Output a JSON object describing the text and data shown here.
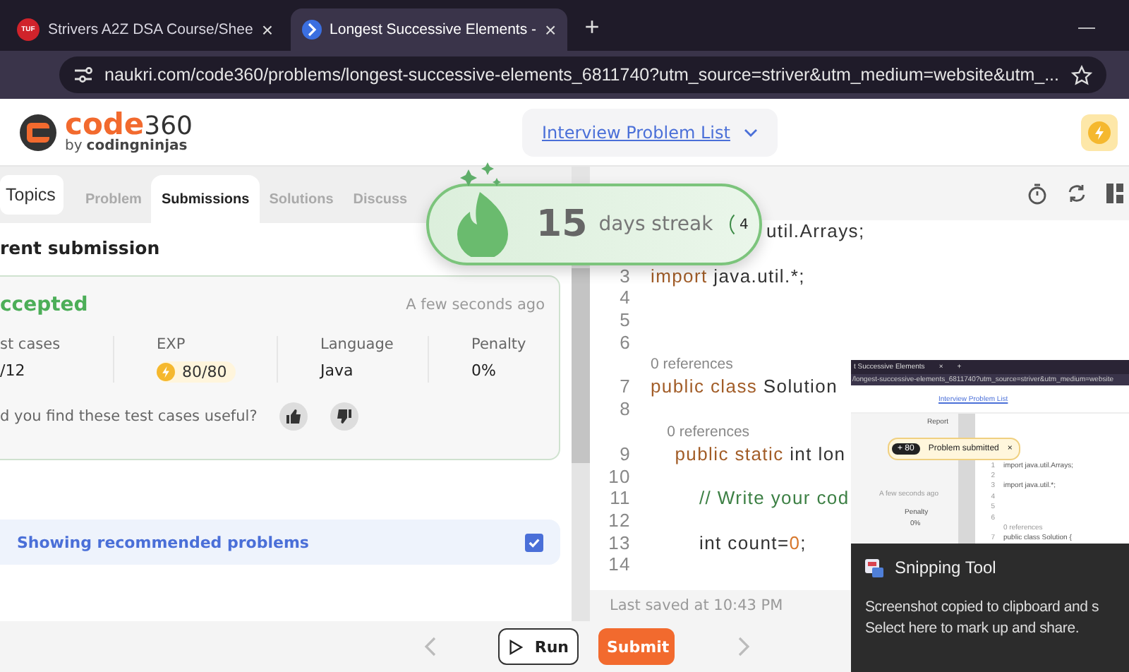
{
  "browser": {
    "tabs": [
      {
        "favicon": "TUF",
        "title": "Strivers A2Z DSA Course/Shee",
        "close": "×",
        "selected": false
      },
      {
        "title": "Longest Successive Elements -",
        "close": "×",
        "selected": true
      }
    ],
    "new_tab": "+",
    "minimize": "—",
    "url": "naukri.com/code360/problems/longest-successive-elements_6811740?utm_source=striver&utm_medium=website&utm_..."
  },
  "header": {
    "logo": {
      "code": "code",
      "num": "360",
      "by": "by",
      "brand": "codingninjas"
    },
    "problem_list": "Interview Problem List"
  },
  "left_panel": {
    "tabs": [
      {
        "label": "Topics",
        "kind": "filter",
        "selected": false
      },
      {
        "label": "Problem",
        "kind": "tab",
        "selected": false
      },
      {
        "label": "Submissions",
        "kind": "tab",
        "selected": true
      },
      {
        "label": "Solutions",
        "kind": "tab",
        "selected": false
      },
      {
        "label": "Discuss",
        "kind": "tab",
        "selected": false
      }
    ],
    "section_title": "rent submission",
    "submission": {
      "status": "ccepted",
      "time": "A few seconds ago",
      "stats": [
        {
          "label": "st cases",
          "value": "/12",
          "kind": "plain"
        },
        {
          "label": "EXP",
          "value": "80/80",
          "kind": "exp"
        },
        {
          "label": "Language",
          "value": "Java",
          "kind": "plain"
        },
        {
          "label": "Penalty",
          "value": "0%",
          "kind": "plain"
        }
      ],
      "feedback": "d you find these test cases useful?"
    },
    "recommended": {
      "label": "Showing recommended problems",
      "checked": true
    }
  },
  "editor": {
    "lines": [
      {
        "kind": "covered",
        "tokens": [
          {
            "t": "util.Arrays;",
            "kind": "plain"
          }
        ]
      },
      {
        "kind": "covered"
      },
      {
        "num": "3",
        "tokens": [
          {
            "t": "import",
            "kind": "keyword"
          },
          {
            "t": " java.util.*;",
            "kind": "plain"
          }
        ]
      },
      {
        "num": "4"
      },
      {
        "num": "5"
      },
      {
        "num": "6"
      },
      {
        "num": "7",
        "refs": "0 references",
        "tokens": [
          {
            "t": "public class",
            "kind": "keyword"
          },
          {
            "t": " Solution",
            "kind": "plain"
          }
        ]
      },
      {
        "num": "8"
      },
      {
        "num": "9",
        "refs": "    0 references",
        "tokens": [
          {
            "t": "    public static",
            "kind": "keyword"
          },
          {
            "t": " int lon",
            "kind": "plain"
          }
        ]
      },
      {
        "num": "10"
      },
      {
        "num": "11",
        "tokens": [
          {
            "t": "        // Write your cod",
            "kind": "comment"
          }
        ]
      },
      {
        "num": "12"
      },
      {
        "num": "13",
        "tokens": [
          {
            "t": "        int count=",
            "kind": "plain"
          },
          {
            "t": "0",
            "kind": "number"
          },
          {
            "t": ";",
            "kind": "plain"
          }
        ]
      },
      {
        "num": "14"
      }
    ],
    "last_saved": "Last saved at 10:43 PM"
  },
  "footer": {
    "run": "Run",
    "submit": "Submit"
  },
  "streak": {
    "count": "15",
    "label": "days streak",
    "freeze": "4"
  },
  "notification": {
    "app": "Snipping Tool",
    "lines": [
      "Screenshot copied to clipboard and s",
      "Select here to mark up and share."
    ],
    "preview": {
      "tab": "t Successive Elements",
      "close": "×",
      "new_tab": "+",
      "url": "/longest-successive-elements_6811740?utm_source=striver&utm_medium=website",
      "link": "Interview Problem List",
      "toast": {
        "points": "+ 80",
        "text": "Problem submitted",
        "close": "×"
      },
      "report": "Report",
      "time": "A few seconds ago",
      "penalty_label": "Penalty",
      "penalty": "0%",
      "code": [
        {
          "num": "1",
          "text": "import java.util.Arrays;"
        },
        {
          "num": "2"
        },
        {
          "num": "3",
          "text": "import java.util.*;"
        },
        {
          "num": "4"
        },
        {
          "num": "5"
        },
        {
          "num": "6"
        },
        {
          "refs": "0 references"
        },
        {
          "num": "7",
          "text": "public class Solution {"
        }
      ]
    }
  }
}
